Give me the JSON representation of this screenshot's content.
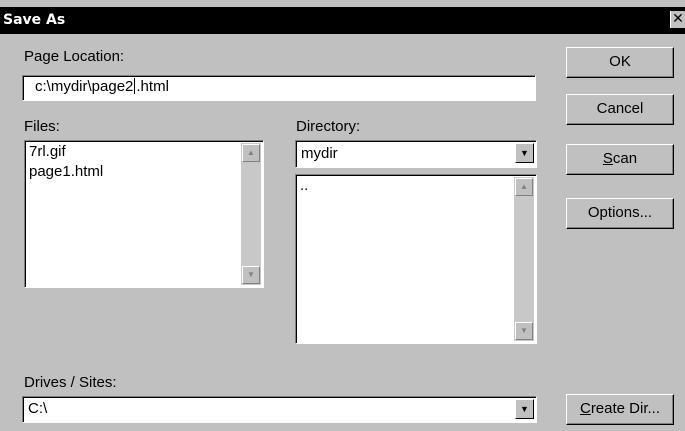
{
  "window": {
    "title": "Save As",
    "close_glyph": "✕"
  },
  "page_location": {
    "label": "Page Location:",
    "value_before_caret": "c:\\mydir\\page2",
    "value_after_caret": ".html"
  },
  "files": {
    "label": "Files:",
    "items": [
      "7rl.gif",
      "page1.html"
    ]
  },
  "directory": {
    "label": "Directory:",
    "selected": "mydir",
    "items": [
      ".."
    ]
  },
  "drives": {
    "label": "Drives / Sites:",
    "selected": "C:\\"
  },
  "buttons": {
    "ok": "OK",
    "cancel": "Cancel",
    "scan_mnemonic": "S",
    "scan_rest": "can",
    "options": "Options...",
    "create_mnemonic": "C",
    "create_rest": "reate Dir..."
  },
  "icons": {
    "scroll_up": "▲",
    "scroll_down": "▼",
    "dropdown": "▼"
  }
}
